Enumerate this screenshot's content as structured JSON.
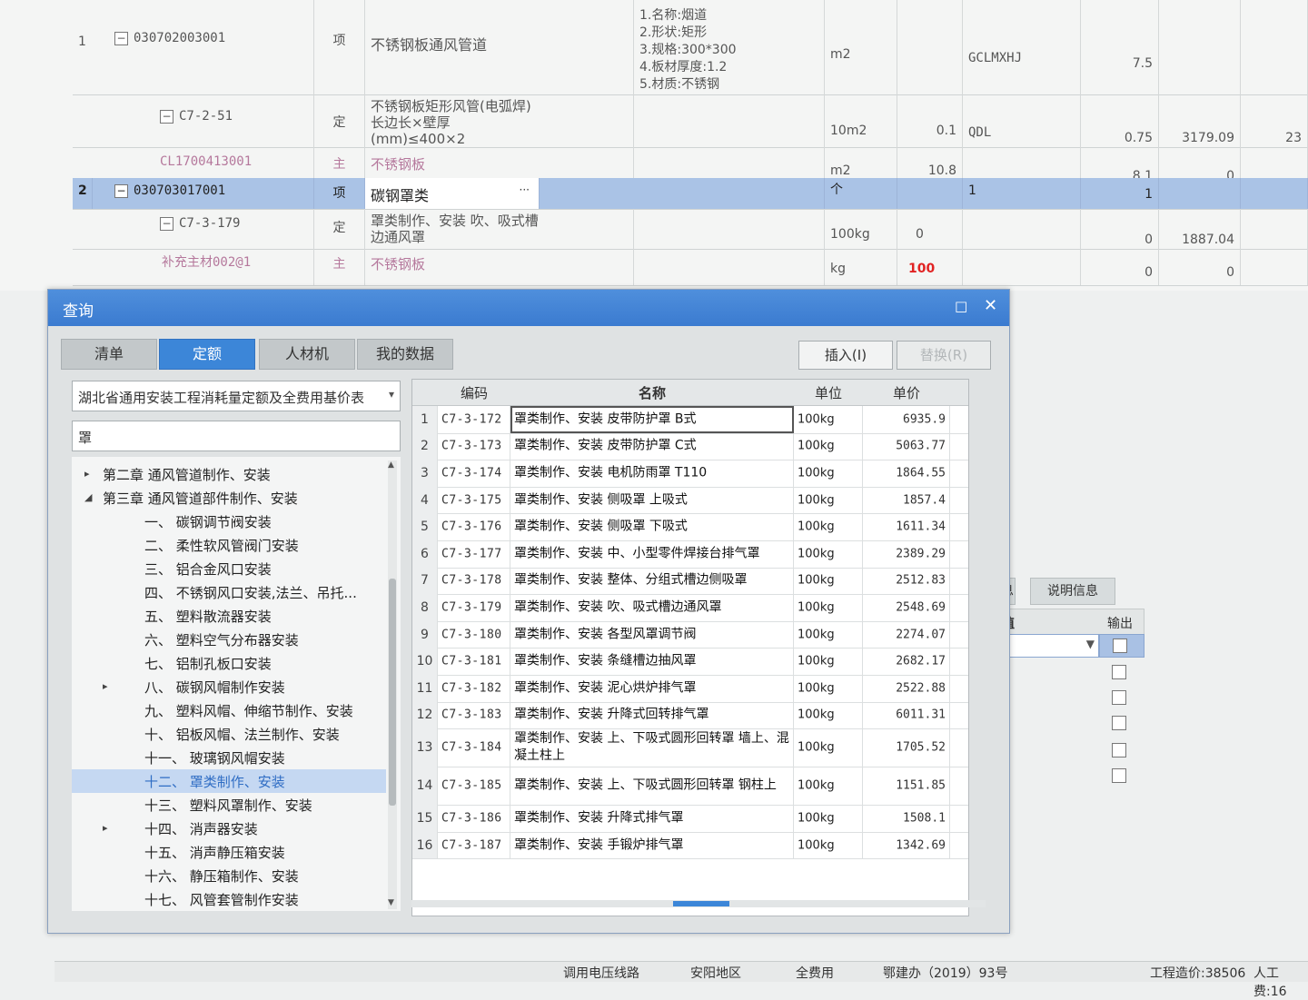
{
  "bg_table": {
    "rows": [
      {
        "no": "1",
        "code": "030702003001",
        "type": "项",
        "name": "不锈钢板通风管道",
        "features": [
          "1.名称:烟道",
          "2.形状:矩形",
          "3.规格:300*300",
          "4.板材厚度:1.2",
          "5.材质:不锈钢"
        ],
        "unit": "m2",
        "qty": "",
        "expr": "GCLMXHJ",
        "v1": "7.5",
        "v2": "",
        "v3": ""
      },
      {
        "no": "",
        "code": "C7-2-51",
        "type": "定",
        "name": "不锈钢板矩形风管(电弧焊)长边长×壁厚(mm)≤400×2",
        "features": [],
        "unit": "10m2",
        "qty": "0.1",
        "expr": "QDL",
        "v1": "0.75",
        "v2": "3179.09",
        "v3": "23"
      },
      {
        "no": "",
        "code": "CL1700413001",
        "type": "主",
        "name": "不锈钢板",
        "features": [],
        "unit": "m2",
        "qty": "10.8",
        "expr": "",
        "v1": "8.1",
        "v2": "0",
        "v3": ""
      },
      {
        "no": "2",
        "code": "030703017001",
        "type": "项",
        "name": "碳钢罩类",
        "features": [],
        "unit": "个",
        "qty": "",
        "expr": "1",
        "v1": "1",
        "v2": "",
        "v3": ""
      },
      {
        "no": "",
        "code": "C7-3-179",
        "type": "定",
        "name": "罩类制作、安装 吹、吸式槽边通风罩",
        "features": [],
        "unit": "100kg",
        "qty": "0",
        "expr": "",
        "v1": "0",
        "v2": "1887.04",
        "v3": ""
      },
      {
        "no": "",
        "code": "补充主材002@1",
        "type": "主",
        "name": "不锈钢板",
        "features": [],
        "unit": "kg",
        "qty": "100",
        "expr": "",
        "v1": "0",
        "v2": "0",
        "v3": ""
      }
    ],
    "ellipsis": "···"
  },
  "side_panel": {
    "tab_cut": "息",
    "tab_label": "说明信息",
    "head_value": "值",
    "head_output": "输出"
  },
  "status": {
    "items": [
      "调用电压线路",
      "安阳地区",
      "全费用",
      "鄂建办（2019）93号",
      "工程造价:38506",
      "人工费:16"
    ]
  },
  "dialog": {
    "title": "查询",
    "max_icon": "□",
    "close_icon": "✕",
    "tabs": [
      "清单",
      "定额",
      "人材机",
      "我的数据"
    ],
    "insert_label": "插入(I)",
    "replace_label": "替换(R)",
    "library": "湖北省通用安装工程消耗量定额及全费用基价表",
    "search_value": "罩",
    "tree": [
      {
        "text": "第二章 通风管道制作、安装",
        "indent": 1,
        "arrow": "▸"
      },
      {
        "text": "第三章 通风管道部件制作、安装",
        "indent": 1,
        "arrow": "◢"
      },
      {
        "text": "一、 碳钢调节阀安装",
        "indent": 2,
        "arrow": ""
      },
      {
        "text": "二、 柔性软风管阀门安装",
        "indent": 2,
        "arrow": ""
      },
      {
        "text": "三、 铝合金风口安装",
        "indent": 2,
        "arrow": ""
      },
      {
        "text": "四、 不锈钢风口安装,法兰、吊托...",
        "indent": 2,
        "arrow": ""
      },
      {
        "text": "五、 塑料散流器安装",
        "indent": 2,
        "arrow": ""
      },
      {
        "text": "六、 塑料空气分布器安装",
        "indent": 2,
        "arrow": ""
      },
      {
        "text": "七、 铝制孔板口安装",
        "indent": 2,
        "arrow": ""
      },
      {
        "text": "八、 碳钢风帽制作安装",
        "indent": 2,
        "arrow": "▸"
      },
      {
        "text": "九、 塑料风帽、伸缩节制作、安装",
        "indent": 2,
        "arrow": ""
      },
      {
        "text": "十、 铝板风帽、法兰制作、安装",
        "indent": 2,
        "arrow": ""
      },
      {
        "text": "十一、 玻璃钢风帽安装",
        "indent": 2,
        "arrow": ""
      },
      {
        "text": "十二、 罩类制作、安装",
        "indent": 2,
        "arrow": "",
        "selected": true
      },
      {
        "text": "十三、 塑料风罩制作、安装",
        "indent": 2,
        "arrow": ""
      },
      {
        "text": "十四、 消声器安装",
        "indent": 2,
        "arrow": "▸"
      },
      {
        "text": "十五、 消声静压箱安装",
        "indent": 2,
        "arrow": ""
      },
      {
        "text": "十六、 静压箱制作、安装",
        "indent": 2,
        "arrow": ""
      },
      {
        "text": "十七、 风管套管制作安装",
        "indent": 2,
        "arrow": ""
      }
    ],
    "grid": {
      "headers": {
        "code": "编码",
        "name": "名称",
        "unit": "单位",
        "price": "单价"
      },
      "rows": [
        {
          "n": "1",
          "code": "C7-3-172",
          "name": "罩类制作、安装 皮带防护罩 B式",
          "unit": "100kg",
          "price": "6935.9"
        },
        {
          "n": "2",
          "code": "C7-3-173",
          "name": "罩类制作、安装 皮带防护罩 C式",
          "unit": "100kg",
          "price": "5063.77"
        },
        {
          "n": "3",
          "code": "C7-3-174",
          "name": "罩类制作、安装 电机防雨罩 T110",
          "unit": "100kg",
          "price": "1864.55"
        },
        {
          "n": "4",
          "code": "C7-3-175",
          "name": "罩类制作、安装 侧吸罩 上吸式",
          "unit": "100kg",
          "price": "1857.4"
        },
        {
          "n": "5",
          "code": "C7-3-176",
          "name": "罩类制作、安装 侧吸罩 下吸式",
          "unit": "100kg",
          "price": "1611.34"
        },
        {
          "n": "6",
          "code": "C7-3-177",
          "name": "罩类制作、安装 中、小型零件焊接台排气罩",
          "unit": "100kg",
          "price": "2389.29"
        },
        {
          "n": "7",
          "code": "C7-3-178",
          "name": "罩类制作、安装 整体、分组式槽边侧吸罩",
          "unit": "100kg",
          "price": "2512.83"
        },
        {
          "n": "8",
          "code": "C7-3-179",
          "name": "罩类制作、安装 吹、吸式槽边通风罩",
          "unit": "100kg",
          "price": "2548.69"
        },
        {
          "n": "9",
          "code": "C7-3-180",
          "name": "罩类制作、安装 各型风罩调节阀",
          "unit": "100kg",
          "price": "2274.07"
        },
        {
          "n": "10",
          "code": "C7-3-181",
          "name": "罩类制作、安装 条缝槽边抽风罩",
          "unit": "100kg",
          "price": "2682.17"
        },
        {
          "n": "11",
          "code": "C7-3-182",
          "name": "罩类制作、安装 泥心烘炉排气罩",
          "unit": "100kg",
          "price": "2522.88"
        },
        {
          "n": "12",
          "code": "C7-3-183",
          "name": "罩类制作、安装 升降式回转排气罩",
          "unit": "100kg",
          "price": "6011.31"
        },
        {
          "n": "13",
          "code": "C7-3-184",
          "name": "罩类制作、安装 上、下吸式圆形回转罩 墙上、混凝土柱上",
          "unit": "100kg",
          "price": "1705.52"
        },
        {
          "n": "14",
          "code": "C7-3-185",
          "name": "罩类制作、安装 上、下吸式圆形回转罩 钢柱上",
          "unit": "100kg",
          "price": "1151.85"
        },
        {
          "n": "15",
          "code": "C7-3-186",
          "name": "罩类制作、安装 升降式排气罩",
          "unit": "100kg",
          "price": "1508.1"
        },
        {
          "n": "16",
          "code": "C7-3-187",
          "name": "罩类制作、安装 手锻炉排气罩",
          "unit": "100kg",
          "price": "1342.69"
        }
      ]
    }
  }
}
